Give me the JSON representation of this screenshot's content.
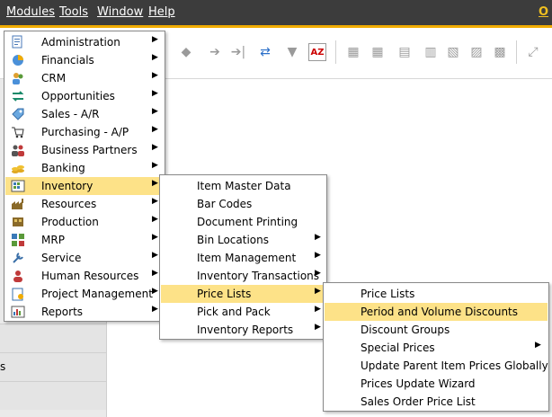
{
  "menubar": {
    "items": [
      "Modules",
      "Tools",
      "Window",
      "Help"
    ],
    "brand": "O"
  },
  "sidepanel": {
    "row_text": "s"
  },
  "modules_menu": {
    "items": [
      {
        "label": "Administration",
        "icon": "administration-icon"
      },
      {
        "label": "Financials",
        "icon": "financials-icon"
      },
      {
        "label": "CRM",
        "icon": "crm-icon"
      },
      {
        "label": "Opportunities",
        "icon": "opportunities-icon"
      },
      {
        "label": "Sales - A/R",
        "icon": "sales-icon"
      },
      {
        "label": "Purchasing - A/P",
        "icon": "purchasing-icon"
      },
      {
        "label": "Business Partners",
        "icon": "business-partners-icon"
      },
      {
        "label": "Banking",
        "icon": "banking-icon"
      },
      {
        "label": "Inventory",
        "icon": "inventory-icon",
        "highlighted": true
      },
      {
        "label": "Resources",
        "icon": "resources-icon"
      },
      {
        "label": "Production",
        "icon": "production-icon"
      },
      {
        "label": "MRP",
        "icon": "mrp-icon"
      },
      {
        "label": "Service",
        "icon": "service-icon"
      },
      {
        "label": "Human Resources",
        "icon": "human-resources-icon"
      },
      {
        "label": "Project Management",
        "icon": "project-management-icon"
      },
      {
        "label": "Reports",
        "icon": "reports-icon"
      }
    ]
  },
  "inventory_menu": {
    "items": [
      {
        "label": "Item Master Data",
        "submenu": false
      },
      {
        "label": "Bar Codes",
        "submenu": false
      },
      {
        "label": "Document Printing",
        "submenu": false
      },
      {
        "label": "Bin Locations",
        "submenu": true
      },
      {
        "label": "Item Management",
        "submenu": true
      },
      {
        "label": "Inventory Transactions",
        "submenu": true
      },
      {
        "label": "Price Lists",
        "submenu": true,
        "highlighted": true
      },
      {
        "label": "Pick and Pack",
        "submenu": true
      },
      {
        "label": "Inventory Reports",
        "submenu": true
      }
    ]
  },
  "price_lists_menu": {
    "items": [
      {
        "label": "Price Lists",
        "submenu": false
      },
      {
        "label": "Period and Volume Discounts",
        "submenu": false,
        "highlighted": true
      },
      {
        "label": "Discount Groups",
        "submenu": false
      },
      {
        "label": "Special Prices",
        "submenu": true
      },
      {
        "label": "Update Parent Item Prices Globally",
        "submenu": false
      },
      {
        "label": "Prices Update Wizard",
        "submenu": false
      },
      {
        "label": "Sales Order Price List",
        "submenu": false
      }
    ]
  },
  "colors": {
    "menubar_bg": "#3c3c3c",
    "accent": "#f0ab00",
    "highlight": "#fde288"
  }
}
